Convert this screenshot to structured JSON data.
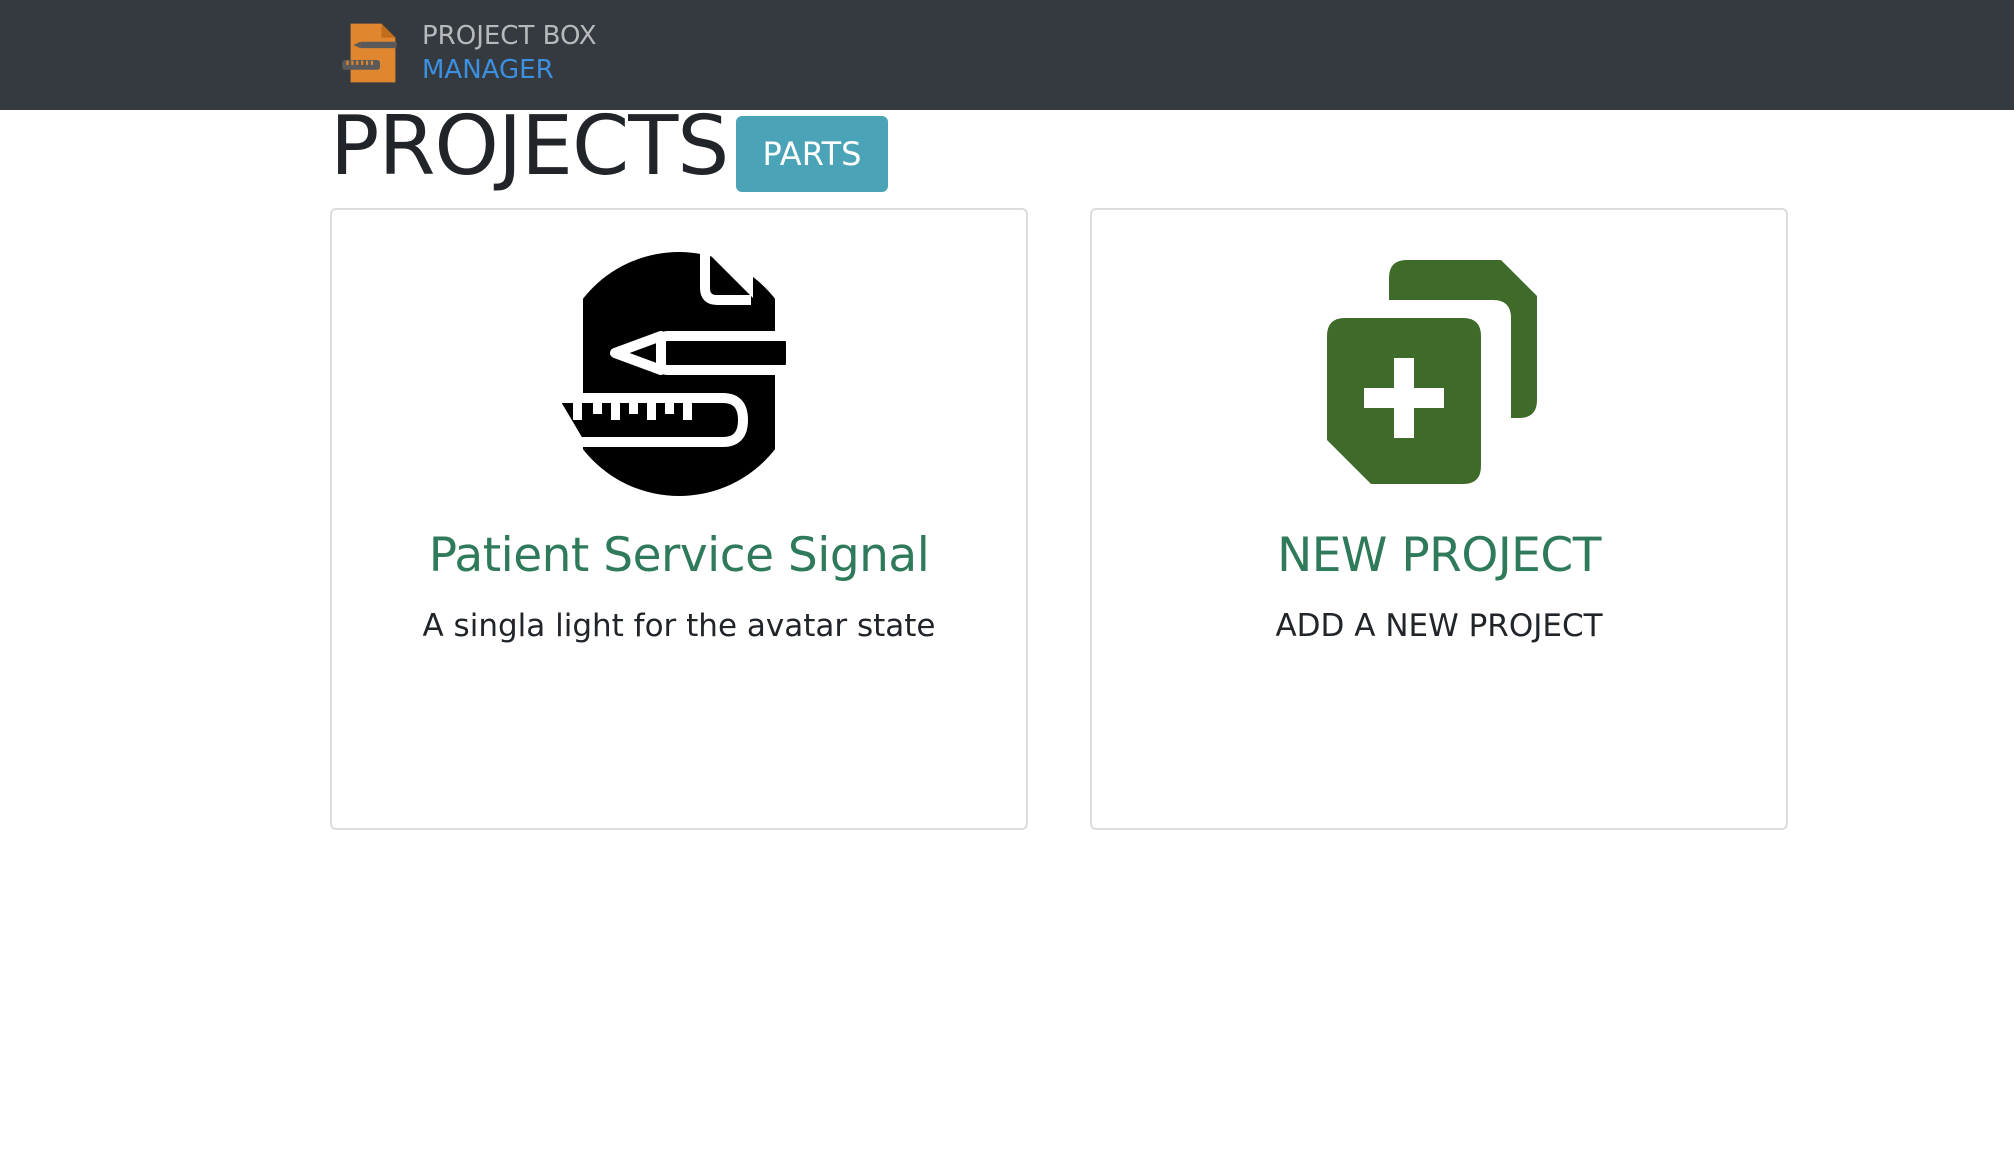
{
  "navbar": {
    "brand_line1": "PROJECT BOX",
    "brand_line2": "MANAGER",
    "logo_icon": "project-box-logo-icon"
  },
  "header": {
    "title": "PROJECTS",
    "parts_button": "PARTS"
  },
  "projects": [
    {
      "icon": "project-ruler-pencil-icon",
      "title": "Patient Service Signal",
      "description": "A singla light for the avatar state"
    },
    {
      "icon": "add-project-icon",
      "title": "NEW PROJECT",
      "description": "ADD A NEW PROJECT"
    }
  ],
  "colors": {
    "navbar_bg": "#343a40",
    "accent_blue": "#3d8fe0",
    "parts_button_bg": "#4aa3b6",
    "card_title": "#2f7a5a",
    "new_project_icon": "#3f6b2a",
    "logo_orange": "#e0862e"
  }
}
